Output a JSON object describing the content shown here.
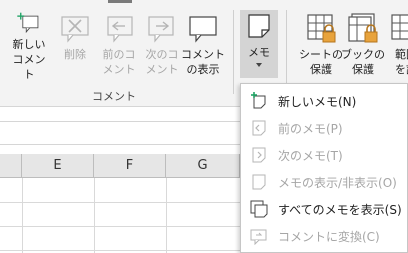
{
  "ribbon": {
    "new_comment": "新しい\nコメント",
    "delete": "削除",
    "prev_comment": "前のコ\nメント",
    "next_comment": "次のコ\nメント",
    "show_comments": "コメント\nの表示",
    "memo": "メモ",
    "protect_sheet": "シートの\n保護",
    "protect_book": "ブックの\n保護",
    "allow_range": "範囲\nを許",
    "group_label": "コメント"
  },
  "grid": {
    "columns": [
      "E",
      "F",
      "G"
    ]
  },
  "memo_menu": {
    "items": [
      {
        "label": "新しいメモ(N)",
        "enabled": true
      },
      {
        "label": "前のメモ(P)",
        "enabled": false
      },
      {
        "label": "次のメモ(T)",
        "enabled": false
      },
      {
        "label": "メモの表示/非表示(O)",
        "enabled": false
      },
      {
        "label": "すべてのメモを表示(S)",
        "enabled": true
      },
      {
        "label": "コメントに変換(C)",
        "enabled": false
      }
    ]
  },
  "colors": {
    "accent_green": "#21a366",
    "lock_gold": "#e8a33c",
    "disabled": "#a6a6a6"
  }
}
